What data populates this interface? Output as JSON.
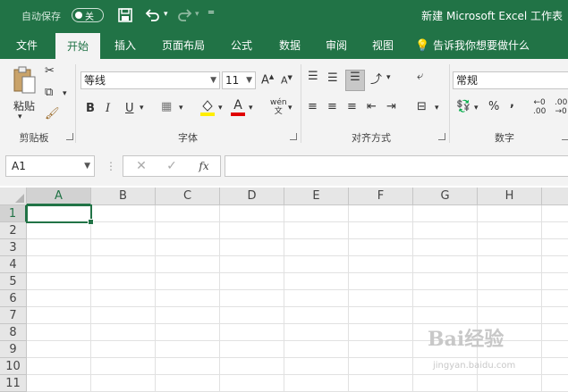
{
  "titlebar": {
    "autosave_label": "自动保存",
    "autosave_state": "关",
    "save_icon": "save-icon",
    "undo_icon": "undo-icon",
    "redo_icon": "redo-icon",
    "customize_icon": "customize-qat-icon",
    "title": "新建 Microsoft Excel 工作表"
  },
  "tabs": [
    {
      "label": "文件"
    },
    {
      "label": "开始"
    },
    {
      "label": "插入"
    },
    {
      "label": "页面布局"
    },
    {
      "label": "公式"
    },
    {
      "label": "数据"
    },
    {
      "label": "审阅"
    },
    {
      "label": "视图"
    },
    {
      "label": "告诉我你想要做什么"
    }
  ],
  "ribbon": {
    "clipboard": {
      "paste_label": "粘贴",
      "group_label": "剪贴板"
    },
    "font": {
      "font_name": "等线",
      "font_size": "11",
      "bold": "B",
      "italic": "I",
      "underline": "U",
      "font_color_letter": "A",
      "phonetic": "wén",
      "group_label": "字体"
    },
    "alignment": {
      "group_label": "对齐方式"
    },
    "number": {
      "format": "常规",
      "percent": "%",
      "comma": ",",
      "group_label": "数字"
    }
  },
  "formula_bar": {
    "name_box": "A1",
    "cancel": "✕",
    "enter": "✓",
    "fx": "fx",
    "value": ""
  },
  "grid": {
    "columns": [
      "A",
      "B",
      "C",
      "D",
      "E",
      "F",
      "G",
      "H"
    ],
    "rows": [
      "1",
      "2",
      "3",
      "4",
      "5",
      "6",
      "7",
      "8",
      "9",
      "10",
      "11"
    ],
    "active_cell": "A1"
  },
  "watermark": {
    "text": "Bai经验",
    "sub": "jingyan.baidu.com"
  },
  "colors": {
    "accent": "#217346",
    "ribbon_bg": "#f3f3f3"
  }
}
